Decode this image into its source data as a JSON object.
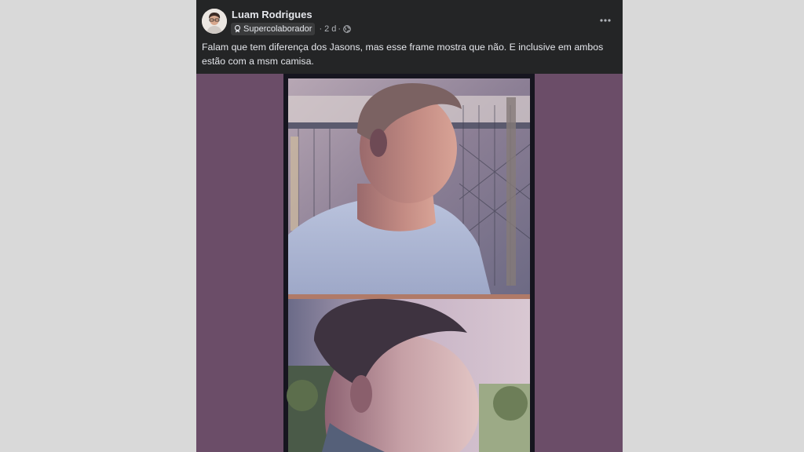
{
  "post": {
    "author_name": "Luam Rodrigues",
    "badge_label": "Supercolaborador",
    "separator": "·",
    "time": "2 d",
    "more_icon": "more-options-icon",
    "caption": "Falam que tem diferença dos Jasons, mas esse frame mostra que não. E inclusive em ambos estão com a msm camisa."
  },
  "colors": {
    "page_background": "#d9d9d9",
    "card_background": "#242526",
    "media_background": "#6b4d68",
    "primary_text": "#e4e6eb",
    "secondary_text": "#b0b3b8"
  }
}
